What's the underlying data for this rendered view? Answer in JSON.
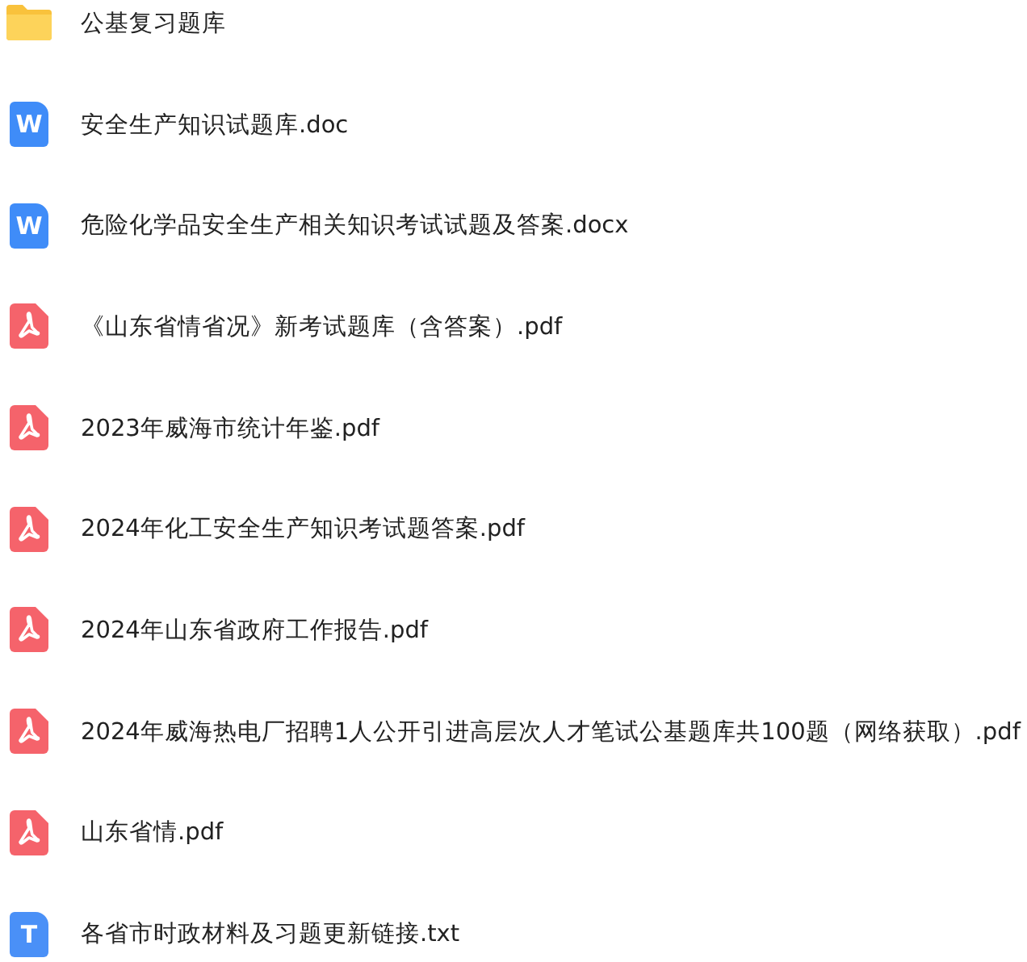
{
  "files": [
    {
      "kind": "folder",
      "name": "公基复习题库"
    },
    {
      "kind": "word",
      "icon_letter": "W",
      "name": "安全生产知识试题库.doc"
    },
    {
      "kind": "word",
      "icon_letter": "W",
      "name": "危险化学品安全生产相关知识考试试题及答案.docx"
    },
    {
      "kind": "pdf",
      "name": "《山东省情省况》新考试题库（含答案）.pdf"
    },
    {
      "kind": "pdf",
      "name": "2023年威海市统计年鉴.pdf"
    },
    {
      "kind": "pdf",
      "name": "2024年化工安全生产知识考试题答案.pdf"
    },
    {
      "kind": "pdf",
      "name": "2024年山东省政府工作报告.pdf"
    },
    {
      "kind": "pdf",
      "name": "2024年威海热电厂招聘1人公开引进高层次人才笔试公基题库共100题（网络获取）.pdf"
    },
    {
      "kind": "pdf",
      "name": "山东省情.pdf"
    },
    {
      "kind": "text",
      "icon_letter": "T",
      "name": "各省市时政材料及习题更新链接.txt"
    }
  ]
}
